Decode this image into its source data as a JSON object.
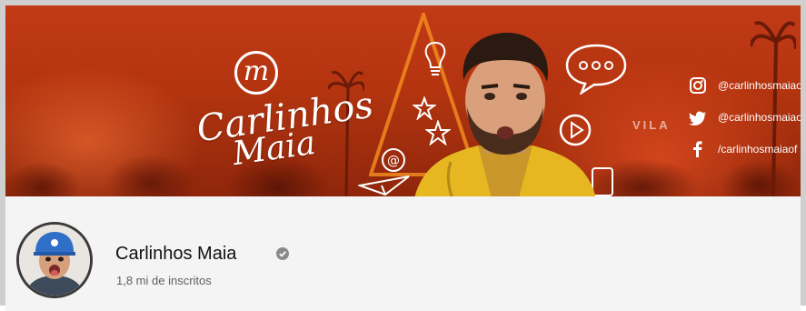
{
  "banner": {
    "logo_mark": "m",
    "logo_line1": "Carlinhos",
    "logo_line2": "Maia",
    "vila_text": "VILA",
    "social": [
      {
        "icon": "instagram-icon",
        "handle": "@carlinhosmaiaof"
      },
      {
        "icon": "twitter-icon",
        "handle": "@carlinhosmaiaof"
      },
      {
        "icon": "facebook-icon",
        "handle": "/carlinhosmaiaof"
      }
    ],
    "colors": {
      "banner_red": "#b3340f",
      "doodle_white": "#ffffff",
      "accent_orange": "#f28a1f"
    }
  },
  "channel": {
    "name": "Carlinhos Maia",
    "subscribers": "1,8 mi de inscritos",
    "verified": true
  }
}
